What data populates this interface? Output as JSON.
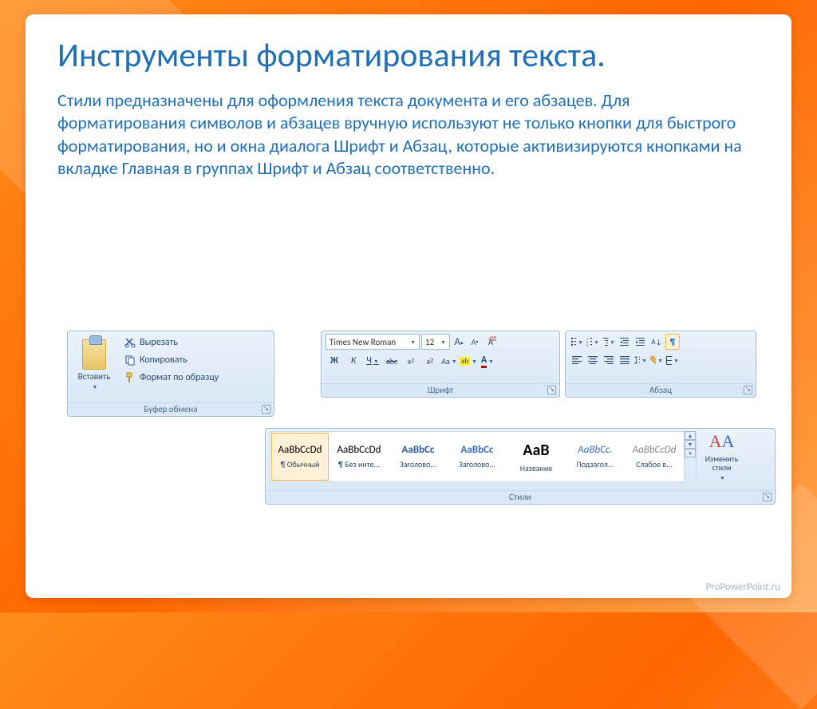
{
  "slide": {
    "title": "Инструменты форматирования текста.",
    "body": "Стили предназначены для оформления текста документа и его абзацев. Для форматирования символов и абзацев вручную используют не только кнопки для быстрого форматирования, но и окна диалога Шрифт и Абзац, которые активизируются кнопками на вкладке Главная в группах Шрифт и Абзац соответственно.",
    "footer": "ProPowerPoint.ru"
  },
  "clipboard": {
    "label": "Буфер обмена",
    "paste": "Вставить",
    "cut": "Вырезать",
    "copy": "Копировать",
    "format_painter": "Формат по образцу"
  },
  "font": {
    "label": "Шрифт",
    "family": "Times New Roman",
    "size": "12",
    "grow": "A",
    "shrink": "A",
    "clear": "Aa",
    "bold": "Ж",
    "italic": "К",
    "underline": "Ч",
    "strike": "abc",
    "sub": "x₂",
    "sup": "x²",
    "case": "Aa",
    "highlight": "ab",
    "color": "A"
  },
  "paragraph": {
    "label": "Абзац",
    "pilcrow": "¶"
  },
  "styles": {
    "label": "Стили",
    "items": [
      {
        "preview": "AaBbCcDd",
        "name": "¶ Обычный",
        "font": "normal",
        "color": "#000"
      },
      {
        "preview": "AaBbCcDd",
        "name": "¶ Без инте...",
        "font": "normal",
        "color": "#000"
      },
      {
        "preview": "AaBbCc",
        "name": "Заголово...",
        "font": "bold",
        "color": "#2a5a9a"
      },
      {
        "preview": "AaBbCc",
        "name": "Заголово...",
        "font": "bold",
        "color": "#3b6fb5"
      },
      {
        "preview": "AaB",
        "name": "Название",
        "font": "bold",
        "color": "#000",
        "size": "20px"
      },
      {
        "preview": "AaBbCc.",
        "name": "Подзагол...",
        "font": "italic",
        "color": "#3b6fb5"
      },
      {
        "preview": "AaBbCcDd",
        "name": "Слабое в...",
        "font": "italic",
        "color": "#888"
      }
    ],
    "change": "Изменить стили"
  }
}
